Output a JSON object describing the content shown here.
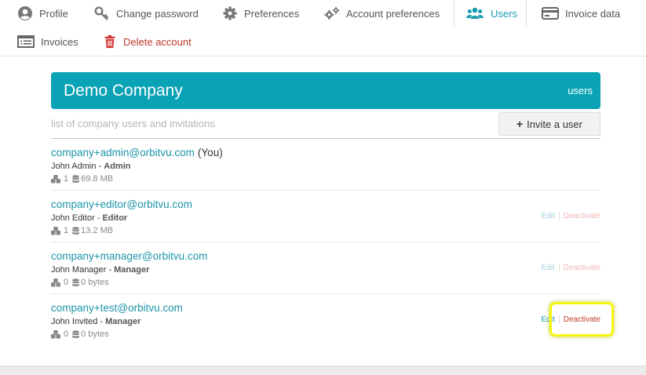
{
  "nav": {
    "tabs": [
      {
        "label": "Profile",
        "icon": "user-circle-icon"
      },
      {
        "label": "Change password",
        "icon": "key-icon"
      },
      {
        "label": "Preferences",
        "icon": "gear-icon"
      },
      {
        "label": "Account preferences",
        "icon": "gears-icon"
      },
      {
        "label": "Users",
        "icon": "users-icon",
        "active": true
      },
      {
        "label": "Invoice data",
        "icon": "credit-card-icon"
      },
      {
        "label": "Invoices",
        "icon": "list-icon"
      },
      {
        "label": "Delete account",
        "icon": "trash-icon"
      }
    ]
  },
  "header": {
    "company": "Demo Company",
    "scope": "users"
  },
  "subtitle": "list of company users and invitations",
  "invite_button": "Invite a user",
  "users": [
    {
      "email": "company+admin@orbitvu.com",
      "you": "(You)",
      "name": "John Admin",
      "role": "Admin",
      "count": "1",
      "storage": "69.8 MB"
    },
    {
      "email": "company+editor@orbitvu.com",
      "name": "John Editor",
      "role": "Editor",
      "count": "1",
      "storage": "13.2 MB",
      "edit": "Edit",
      "deactivate": "Deactivate"
    },
    {
      "email": "company+manager@orbitvu.com",
      "name": "John Manager",
      "role": "Manager",
      "count": "0",
      "storage": "0 bytes",
      "edit": "Edit",
      "deactivate": "Deactivate"
    },
    {
      "email": "company+test@orbitvu.com",
      "name": "John Invited",
      "role": "Manager",
      "count": "0",
      "storage": "0 bytes",
      "edit": "Edit",
      "deactivate": "Deactivate"
    }
  ],
  "colors": {
    "accent": "#0aa3b5",
    "link": "#1c95a8",
    "danger": "#c0392b",
    "highlight": "#f5f50c"
  }
}
